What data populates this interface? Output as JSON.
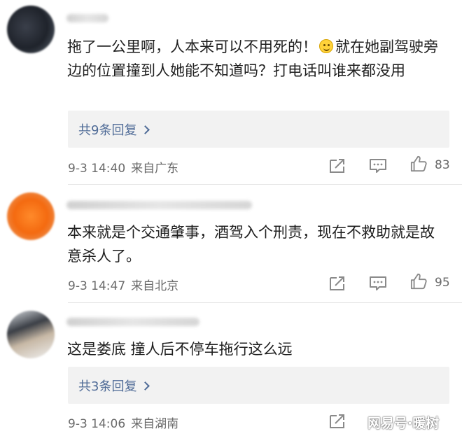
{
  "comments": [
    {
      "text_part1": "拖了一公里啊，人本来可以不用死的！",
      "text_part2": "就在她副驾驶旁边的位置撞到人她能不知道吗？打电话叫谁来都没用",
      "emoji": "smile-emoji",
      "reply_label": "共9条回复",
      "date": "9-3 14:40",
      "location": "来自广东",
      "likes": "83"
    },
    {
      "text": "本来就是个交通肇事，酒驾入个刑责，现在不救助就是故意杀人了。",
      "date": "9-3 14:47",
      "location": "来自北京",
      "likes": "95"
    },
    {
      "text": "这是娄底 撞人后不停车拖行这么远",
      "reply_label": "共3条回复",
      "date": "9-3 14:06",
      "location": "来自湖南"
    }
  ],
  "watermark": "网易号·暖树",
  "colors": {
    "link": "#4f6b97",
    "reply_bg": "#f2f2f2",
    "meta": "#6a6a6a"
  }
}
